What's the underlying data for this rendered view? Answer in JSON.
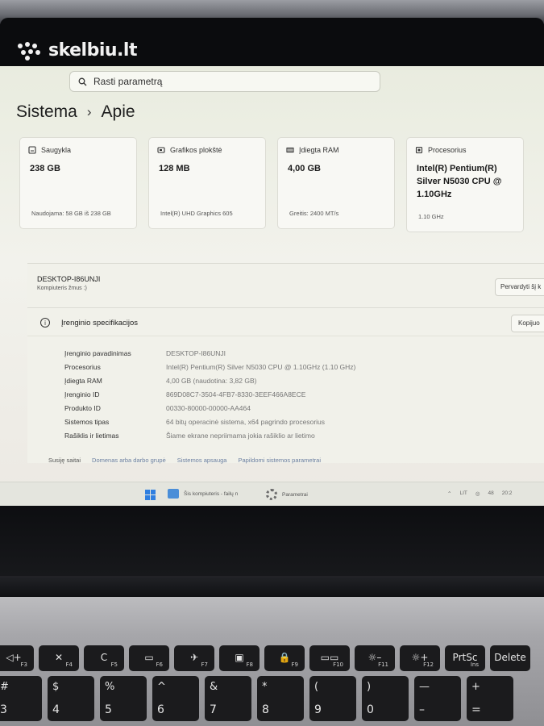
{
  "brand": {
    "name": "skelbiu.lt"
  },
  "search": {
    "placeholder": "Rasti parametrą"
  },
  "breadcrumb": {
    "parent": "Sistema",
    "separator": "›",
    "current": "Apie"
  },
  "cards": [
    {
      "id": "storage",
      "icon": "storage-icon",
      "title": "Saugykla",
      "value": "238 GB",
      "footer": "Naudojama: 58 GB iš 238 GB"
    },
    {
      "id": "gpu",
      "icon": "graphics-card-icon",
      "title": "Grafikos plokštė",
      "value": "128 MB",
      "footer": "Intel(R) UHD Graphics 605"
    },
    {
      "id": "ram",
      "icon": "ram-icon",
      "title": "Įdiegta RAM",
      "value": "4,00 GB",
      "footer": "Greitis: 2400 MT/s"
    },
    {
      "id": "cpu",
      "icon": "processor-icon",
      "title": "Procesorius",
      "value": "Intel(R) Pentium(R) Silver N5030 CPU @ 1.10GHz",
      "footer": "1.10 GHz"
    }
  ],
  "device": {
    "name": "DESKTOP-I86UNJI",
    "subtitle": "Kompiuteris žmus :)",
    "rename_label": "Pervardyti šį k"
  },
  "specs": {
    "title": "Įrenginio specifikacijos",
    "copy_label": "Kopijuo",
    "rows": [
      {
        "label": "Įrenginio pavadinimas",
        "value": "DESKTOP-I86UNJI"
      },
      {
        "label": "Procesorius",
        "value": "Intel(R) Pentium(R) Silver N5030 CPU @ 1.10GHz (1.10 GHz)"
      },
      {
        "label": "Įdiegta RAM",
        "value": "4,00 GB (naudotina: 3,82 GB)"
      },
      {
        "label": "Įrenginio ID",
        "value": "869D08C7-3504-4FB7-8330-3EEF466A8ECE"
      },
      {
        "label": "Produkto ID",
        "value": "00330-80000-00000-AA464"
      },
      {
        "label": "Sistemos tipas",
        "value": "64 bitų operacinė sistema, x64 pagrindo procesorius"
      },
      {
        "label": "Rašiklis ir lietimas",
        "value": "Šiame ekrane nepriimama jokia rašiklio ar lietimo"
      }
    ]
  },
  "related": {
    "label": "Susiję saitai",
    "links": [
      "Domenas arba darbo grupė",
      "Sistemos apsauga",
      "Papildomi sistemos parametrai"
    ]
  },
  "taskbar": {
    "items": [
      "Šis kompiuteris - failų n",
      "Parametrai"
    ],
    "tray": [
      "LIT",
      "48",
      "20:2"
    ]
  },
  "keyboard": {
    "fn_row": [
      {
        "icon": "◁+",
        "sub": "F3"
      },
      {
        "icon": "✕",
        "sub": "F4"
      },
      {
        "icon": "C",
        "sub": "F5"
      },
      {
        "icon": "▭",
        "sub": "F6"
      },
      {
        "icon": "✈",
        "sub": "F7"
      },
      {
        "icon": "▣",
        "sub": "F8"
      },
      {
        "icon": "🔒",
        "sub": "F9"
      },
      {
        "icon": "▭▭",
        "sub": "F10"
      },
      {
        "icon": "☼–",
        "sub": "F11"
      },
      {
        "icon": "☼+",
        "sub": "F12"
      },
      {
        "icon": "PrtSc",
        "sub": "Ins"
      },
      {
        "icon": "Delete",
        "sub": ""
      }
    ],
    "num_row": [
      {
        "tl": "#",
        "tr": "",
        "bl": "3",
        "br": ""
      },
      {
        "tl": "$",
        "tr": "",
        "bl": "4",
        "br": ""
      },
      {
        "tl": "%",
        "tr": "",
        "bl": "5",
        "br": ""
      },
      {
        "tl": "^",
        "tr": "",
        "bl": "6",
        "br": ""
      },
      {
        "tl": "&",
        "tr": "",
        "bl": "7",
        "br": ""
      },
      {
        "tl": "*",
        "tr": "",
        "bl": "8",
        "br": ""
      },
      {
        "tl": "(",
        "tr": "",
        "bl": "9",
        "br": ""
      },
      {
        "tl": ")",
        "tr": "",
        "bl": "0",
        "br": ""
      },
      {
        "tl": "—",
        "tr": "",
        "bl": "–",
        "br": ""
      },
      {
        "tl": "+",
        "tr": "",
        "bl": "=",
        "br": ""
      }
    ]
  }
}
